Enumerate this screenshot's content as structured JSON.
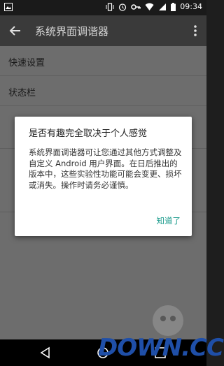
{
  "status_bar": {
    "time": "09:34"
  },
  "toolbar": {
    "title": "系统界面调谐器"
  },
  "list_items": [
    {
      "label": "快速设置"
    },
    {
      "label": "状态栏"
    }
  ],
  "dialog": {
    "title": "是否有趣完全取决于个人感觉",
    "message": "系统界面调谐器可让您通过其他方式调整及自定义 Android 用户界面。在日后推出的版本中，这些实验性功能可能会变更、损坏或消失。操作时请务必谨慎。",
    "ok_button": "知道了"
  },
  "watermark": {
    "text": "DOWN.CC"
  },
  "colors": {
    "accent": "#1b9b8c",
    "toolbar": "#3a3a3a",
    "scrim_list": "#6d6d6d"
  }
}
